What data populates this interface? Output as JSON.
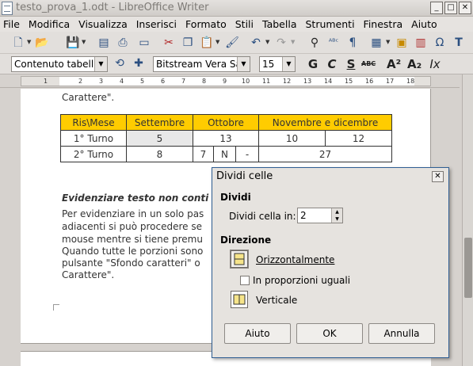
{
  "window": {
    "title": "testo_prova_1.odt - LibreOffice Writer"
  },
  "menu": [
    "File",
    "Modifica",
    "Visualizza",
    "Inserisci",
    "Formato",
    "Stili",
    "Tabella",
    "Strumenti",
    "Finestra",
    "Aiuto"
  ],
  "toolbar2": {
    "style": "Contenuto tabella",
    "font": "Bitstream Vera Sar",
    "size": "15"
  },
  "ruler": {
    "numbers": [
      "1",
      "2",
      "3",
      "4",
      "5",
      "6",
      "7",
      "8",
      "9",
      "10",
      "11",
      "12",
      "13",
      "14",
      "15",
      "16",
      "17",
      "18"
    ]
  },
  "document": {
    "line0": "Carattere\".",
    "table": {
      "header": [
        "Ris\\Mese",
        "Settembre",
        "Ottobre",
        "Novembre e dicembre"
      ],
      "row1": {
        "label": "1° Turno",
        "sett": "5",
        "ott": "13",
        "nov": "10",
        "dic": "12"
      },
      "row2": {
        "label": "2° Turno",
        "sett": "8",
        "o1": "7",
        "o2": "N",
        "o3": "-",
        "nd": "27"
      }
    },
    "heading": "Evidenziare testo non conti",
    "para": [
      "Per evidenziare in un solo pas",
      "adiacenti si può procedere se",
      "mouse mentre si tiene premu",
      "Quando tutte le porzioni sono",
      "pulsante \"Sfondo caratteri\" o",
      "Carattere\"."
    ]
  },
  "dialog": {
    "title": "Dividi celle",
    "section_divide": "Dividi",
    "divide_label": "Dividi cella in:",
    "divide_value": "2",
    "section_direction": "Direzione",
    "horizontal": "Orizzontalmente",
    "equal": "In proporzioni uguali",
    "vertical": "Verticale",
    "btn_help": "Aiuto",
    "btn_ok": "OK",
    "btn_cancel": "Annulla"
  }
}
